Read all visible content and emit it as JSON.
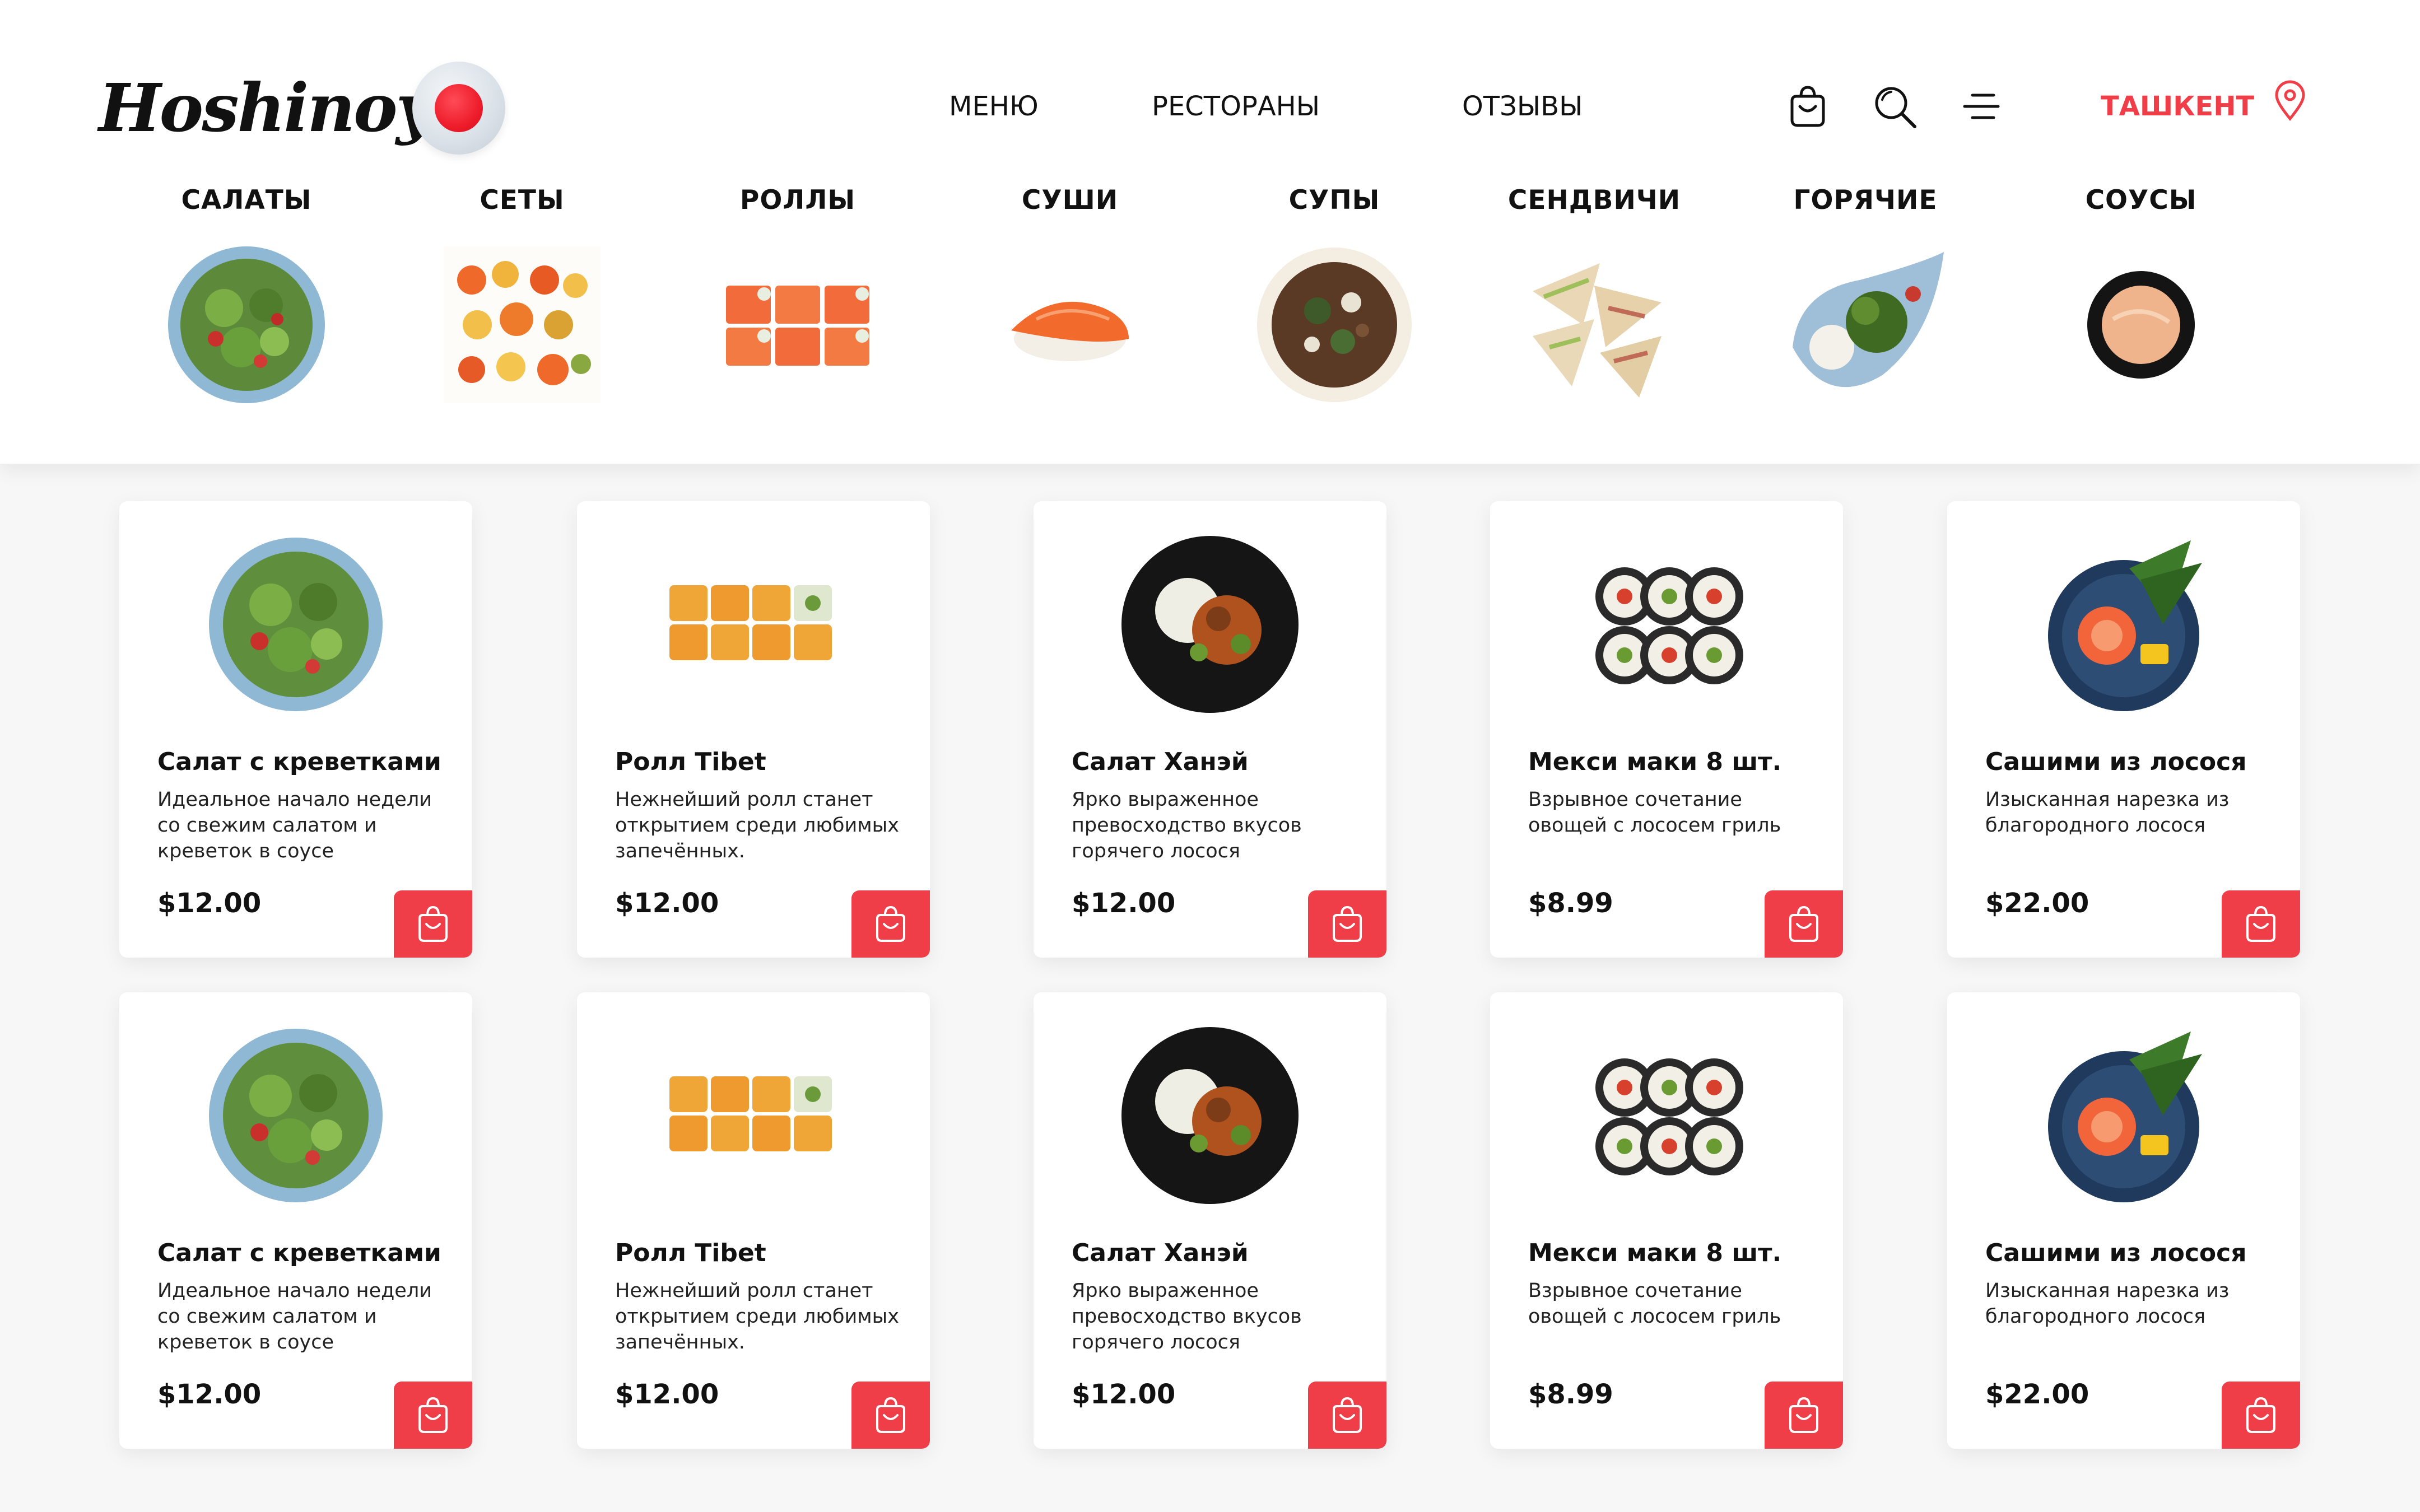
{
  "header": {
    "logo_text": "Hoshinoya",
    "nav": [
      "МЕНЮ",
      "РЕСТОРАНЫ",
      "ОТЗЫВЫ"
    ],
    "city": "ТАШКЕНТ",
    "icons": [
      "cart-icon",
      "search-icon",
      "menu-icon",
      "location-pin-icon"
    ],
    "accent_color": "#ef3e48"
  },
  "categories": [
    {
      "label": "САЛАТЫ",
      "icon": "salad-bowl"
    },
    {
      "label": "СЕТЫ",
      "icon": "sushi-set"
    },
    {
      "label": "РОЛЛЫ",
      "icon": "salmon-rolls"
    },
    {
      "label": "СУШИ",
      "icon": "nigiri"
    },
    {
      "label": "СУПЫ",
      "icon": "soup-bowl"
    },
    {
      "label": "СЕНДВИЧИ",
      "icon": "sandwiches"
    },
    {
      "label": "ГОРЯЧИЕ",
      "icon": "hot-dish"
    },
    {
      "label": "СОУСЫ",
      "icon": "sauce-bowl"
    }
  ],
  "products": [
    {
      "title": "Салат с креветками",
      "desc": "Идеальное начало недели со свежим салатом и креветок в соусе",
      "price": "$12.00"
    },
    {
      "title": "Ролл Tibet",
      "desc": "Нежнейший ролл станет открытием среди любимых запечённых.",
      "price": "$12.00"
    },
    {
      "title": "Салат Ханэй",
      "desc": "Ярко выраженное превосходство вкусов горячего лосося",
      "price": "$12.00"
    },
    {
      "title": "Мекси маки 8 шт.",
      "desc": "Взрывное сочетание овощей с лососем гриль",
      "price": "$8.99"
    },
    {
      "title": "Сашими из лосося",
      "desc": "Изысканная нарезка из благородного лосося",
      "price": "$22.00"
    },
    {
      "title": "Салат с креветками",
      "desc": "Идеальное начало недели со свежим салатом и креветок в соусе",
      "price": "$12.00"
    },
    {
      "title": "Ролл Tibet",
      "desc": "Нежнейший ролл станет открытием среди любимых запечённых.",
      "price": "$12.00"
    },
    {
      "title": "Салат Ханэй",
      "desc": "Ярко выраженное превосходство вкусов горячего лосося",
      "price": "$12.00"
    },
    {
      "title": "Мекси маки 8 шт.",
      "desc": "Взрывное сочетание овощей с лососем гриль",
      "price": "$8.99"
    },
    {
      "title": "Сашими из лосося",
      "desc": "Изысканная нарезка из благородного лосося",
      "price": "$22.00"
    }
  ]
}
